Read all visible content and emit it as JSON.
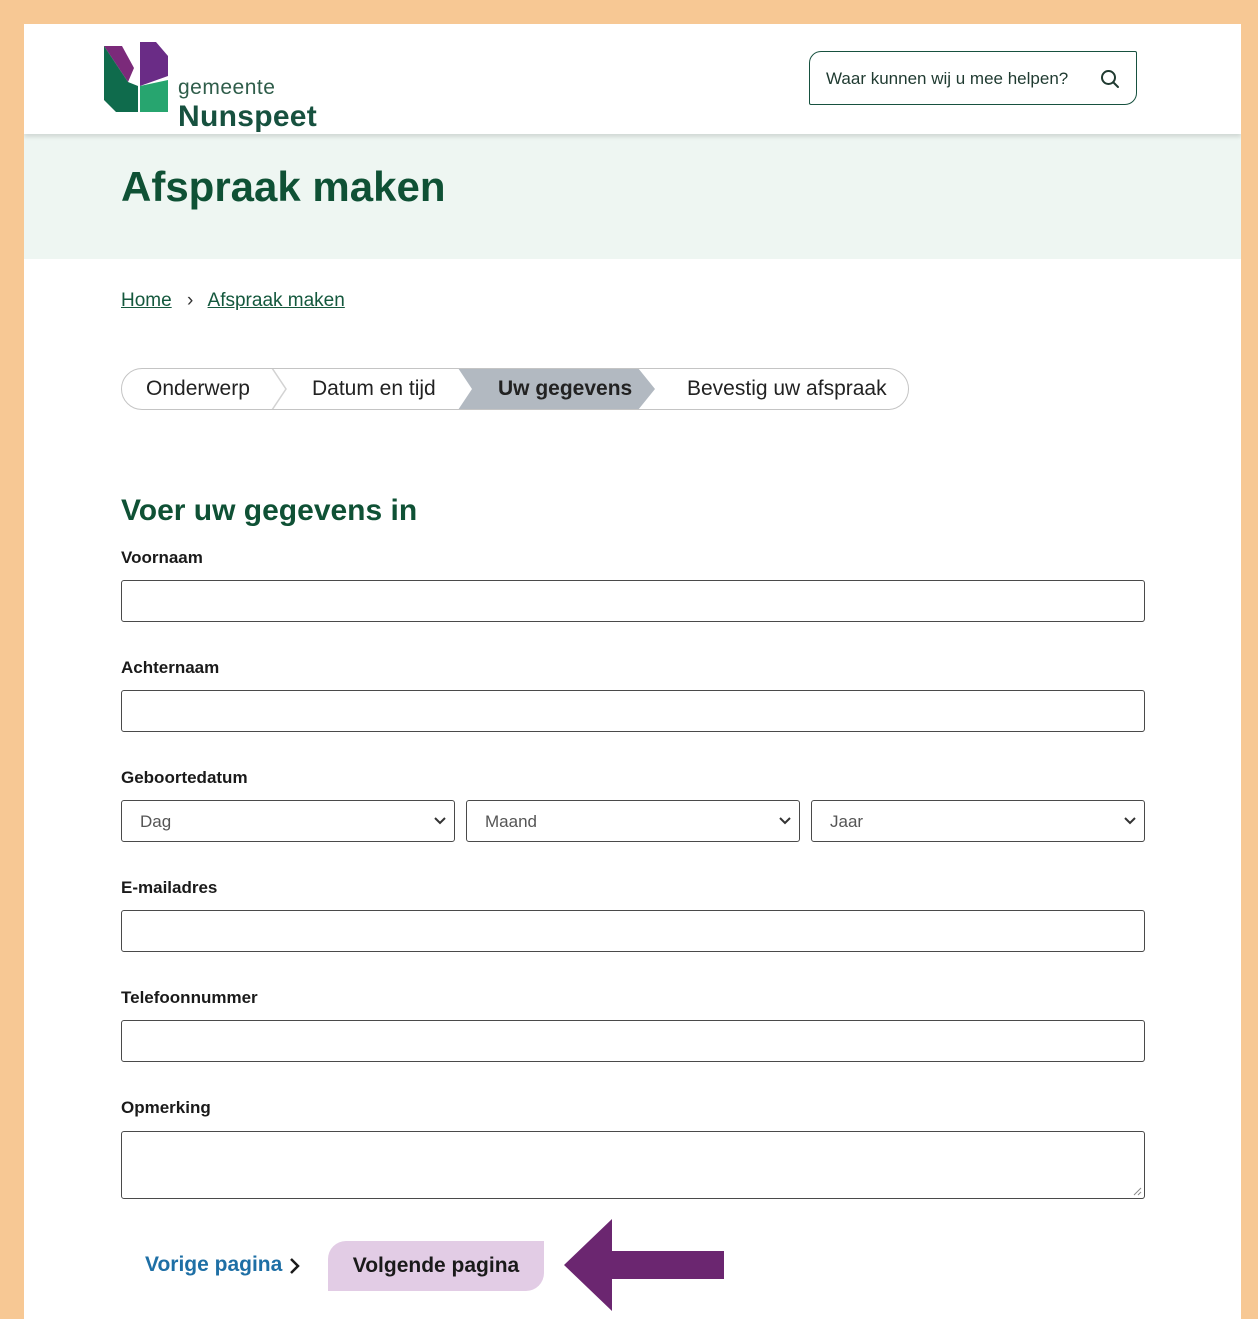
{
  "header": {
    "logo_small": "gemeente",
    "logo_big": "Nunspeet",
    "search_placeholder": "Waar kunnen wij u mee helpen?"
  },
  "hero": {
    "title": "Afspraak maken"
  },
  "breadcrumb": {
    "home": "Home",
    "separator": "›",
    "current": "Afspraak maken"
  },
  "steps": [
    {
      "label": "Onderwerp",
      "active": false
    },
    {
      "label": "Datum en tijd",
      "active": false
    },
    {
      "label": "Uw gegevens",
      "active": true
    },
    {
      "label": "Bevestig uw afspraak",
      "active": false
    }
  ],
  "form": {
    "heading": "Voer uw gegevens in",
    "first_name_label": "Voornaam",
    "last_name_label": "Achternaam",
    "birthdate_label": "Geboortedatum",
    "day_value": "Dag",
    "month_value": "Maand",
    "year_value": "Jaar",
    "email_label": "E-mailadres",
    "phone_label": "Telefoonnummer",
    "remark_label": "Opmerking"
  },
  "nav": {
    "previous": "Vorige pagina",
    "next": "Volgende pagina"
  },
  "colors": {
    "brand_green": "#17513f",
    "hero_bg": "#eef6f2",
    "active_step": "#b2b9c1",
    "next_button": "#e2cce5",
    "link_blue": "#1e6fa5",
    "annotation_arrow": "#6b2670",
    "page_border": "#f7c894"
  }
}
